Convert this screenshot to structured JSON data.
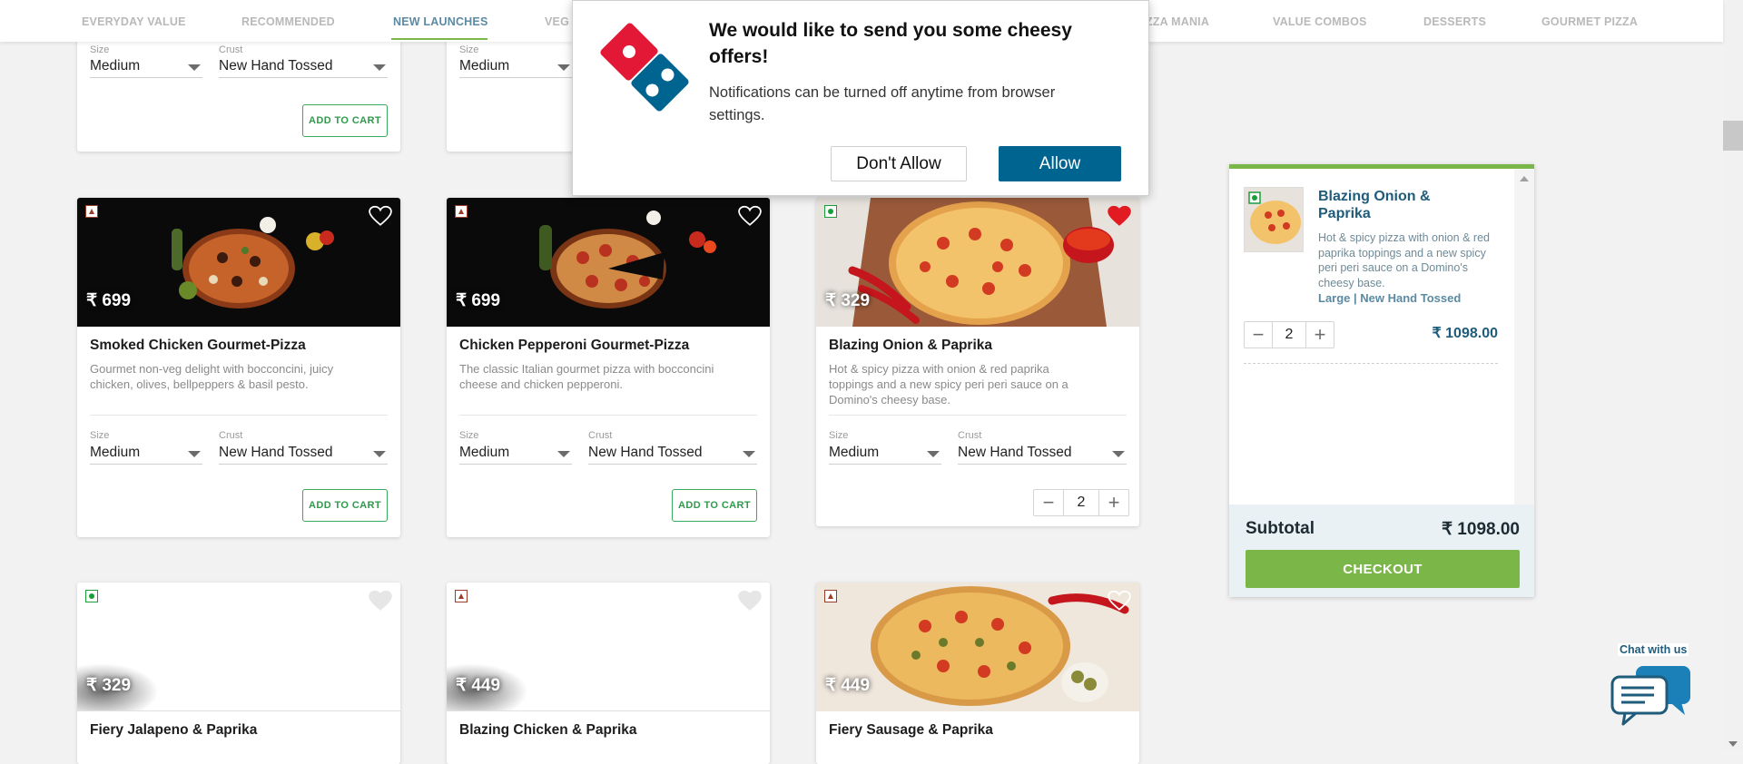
{
  "nav": {
    "tabs": [
      {
        "label": "EVERYDAY VALUE"
      },
      {
        "label": "RECOMMENDED"
      },
      {
        "label": "NEW LAUNCHES"
      },
      {
        "label": "VEG"
      },
      {
        "label": "ZZA MANIA"
      },
      {
        "label": "VALUE COMBOS"
      },
      {
        "label": "DESSERTS"
      },
      {
        "label": "GOURMET PIZZA"
      }
    ],
    "active": "NEW LAUNCHES"
  },
  "top_cards": [
    {
      "size_label": "Size",
      "size": "Medium",
      "crust_label": "Crust",
      "crust": "New Hand Tossed",
      "button": "ADD TO CART"
    },
    {
      "size_label": "Size",
      "size": "Medium"
    }
  ],
  "cards": [
    {
      "price": "₹ 699",
      "name": "Smoked Chicken Gourmet-Pizza",
      "desc": "Gourmet non-veg delight with bocconcini, juicy chicken, olives, bellpeppers & basil pesto.",
      "size_label": "Size",
      "size": "Medium",
      "crust_label": "Crust",
      "crust": "New Hand Tossed",
      "button": "ADD TO CART",
      "type": "non-veg",
      "favorite": false
    },
    {
      "price": "₹ 699",
      "name": "Chicken Pepperoni Gourmet-Pizza",
      "desc": "The classic Italian gourmet pizza with bocconcini cheese and chicken pepperoni.",
      "size_label": "Size",
      "size": "Medium",
      "crust_label": "Crust",
      "crust": "New Hand Tossed",
      "button": "ADD TO CART",
      "type": "non-veg",
      "favorite": false
    },
    {
      "price": "₹ 329",
      "name": "Blazing Onion & Paprika",
      "desc": "Hot & spicy pizza with onion & red paprika toppings and a new spicy peri peri sauce on a Domino's cheesy base.",
      "size_label": "Size",
      "size": "Medium",
      "crust_label": "Crust",
      "crust": "New Hand Tossed",
      "quantity": "2",
      "type": "veg",
      "favorite": true
    },
    {
      "price": "₹ 329",
      "name": "Fiery Jalapeno & Paprika",
      "type": "veg"
    },
    {
      "price": "₹ 449",
      "name": "Blazing Chicken & Paprika",
      "type": "non-veg"
    },
    {
      "price": "₹ 449",
      "name": "Fiery Sausage & Paprika",
      "type": "non-veg"
    }
  ],
  "popup": {
    "heading": "We would like to send you some cheesy offers!",
    "body": "Notifications can be turned off anytime from browser settings.",
    "deny": "Don't Allow",
    "allow": "Allow"
  },
  "cart": {
    "item": {
      "name": "Blazing Onion & Paprika",
      "desc": "Hot & spicy pizza with onion & red paprika toppings and a new spicy peri peri sauce on a Domino's cheesy base.",
      "options": "Large | New Hand Tossed",
      "quantity": "2",
      "price": "₹ 1098.00"
    },
    "subtotal_label": "Subtotal",
    "subtotal": "₹ 1098.00",
    "checkout": "CHECKOUT"
  },
  "chat": {
    "label": "Chat with us"
  },
  "colors": {
    "accent_green": "#7ab648",
    "brand_blue": "#006491",
    "title_blue": "#1f5b7a",
    "favorite_red": "#e21b23"
  }
}
